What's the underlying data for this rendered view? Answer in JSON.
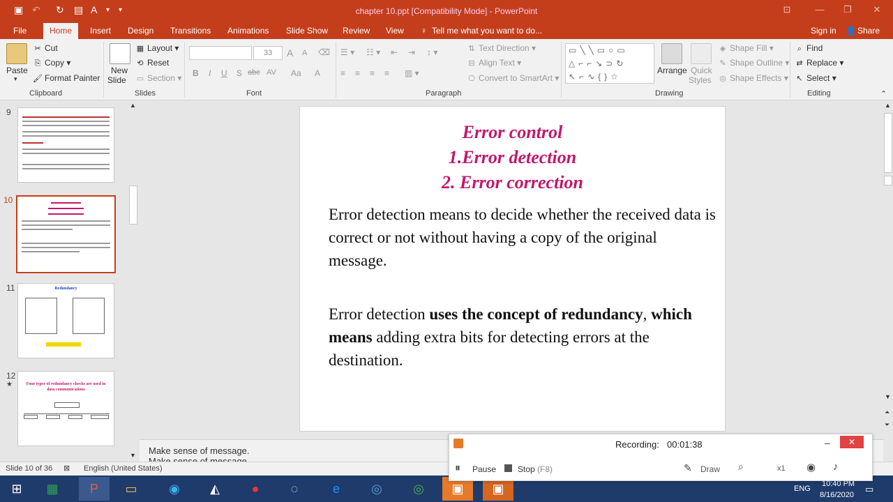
{
  "window": {
    "title": "chapter 10.ppt [Compatibility Mode] - PowerPoint",
    "minimize": "—",
    "restore": "❐",
    "close": "✕"
  },
  "tabs": [
    {
      "label": "File"
    },
    {
      "label": "Home"
    },
    {
      "label": "Insert"
    },
    {
      "label": "Design"
    },
    {
      "label": "Transitions"
    },
    {
      "label": "Animations"
    },
    {
      "label": "Slide Show"
    },
    {
      "label": "Review"
    },
    {
      "label": "View"
    }
  ],
  "tell_me": "Tell me what you want to do...",
  "sign_in": "Sign in",
  "share": "Share",
  "ribbon": {
    "clipboard": {
      "paste": "Paste",
      "cut": "Cut",
      "copy": "Copy",
      "format_painter": "Format Painter",
      "label": "Clipboard"
    },
    "slides": {
      "new_slide_1": "New",
      "new_slide_2": "Slide",
      "layout": "Layout",
      "reset": "Reset",
      "section": "Section",
      "label": "Slides"
    },
    "font": {
      "size": "33",
      "label": "Font",
      "bold": "B",
      "italic": "I",
      "underline": "U",
      "shadow": "S",
      "strike": "abc",
      "spacing": "AV",
      "case": "Aa",
      "color": "A",
      "grow": "A",
      "shrink": "A"
    },
    "paragraph": {
      "text_direction": "Text Direction",
      "align_text": "Align Text",
      "convert": "Convert to SmartArt",
      "label": "Paragraph"
    },
    "drawing": {
      "arrange": "Arrange",
      "quick_styles_1": "Quick",
      "quick_styles_2": "Styles",
      "shape_fill": "Shape Fill",
      "shape_outline": "Shape Outline",
      "shape_effects": "Shape Effects",
      "label": "Drawing"
    },
    "editing": {
      "find": "Find",
      "replace": "Replace",
      "select": "Select",
      "label": "Editing"
    }
  },
  "thumbnails": [
    {
      "number": "9",
      "star": ""
    },
    {
      "number": "10",
      "star": ""
    },
    {
      "number": "11",
      "star": "",
      "title": "Redundancy"
    },
    {
      "number": "12",
      "star": "★",
      "title": "Four types of redundancy checks are used in data communications"
    }
  ],
  "slide": {
    "title_1": "Error control",
    "title_2": "1.Error detection",
    "title_3": "2. Error correction",
    "para1": "Error detection means to decide whether the received data is correct or not without having a copy of the original message.",
    "para2_a": "Error detection ",
    "para2_b": "uses the concept of redundancy",
    "para2_c": ", ",
    "para2_d": "which means",
    "para2_e": " adding extra bits for detecting errors at the destination."
  },
  "notes": {
    "line1": "Make sense of message.",
    "line2": "Make sense of message."
  },
  "status": {
    "slide": "Slide 10 of 36",
    "language": "English (United States)"
  },
  "recorder": {
    "label": "Recording:",
    "time": "00:01:38",
    "pause": "Pause",
    "stop": "Stop",
    "stop_key": "(F8)",
    "draw": "Draw",
    "x1": "x1"
  },
  "taskbar": {
    "lang": "ENG",
    "time": "10:40 PM",
    "date": "8/16/2020"
  },
  "colors": {
    "accent": "#c43e1c",
    "slide_title": "#c2186b",
    "taskbar": "#1f3b6b"
  }
}
